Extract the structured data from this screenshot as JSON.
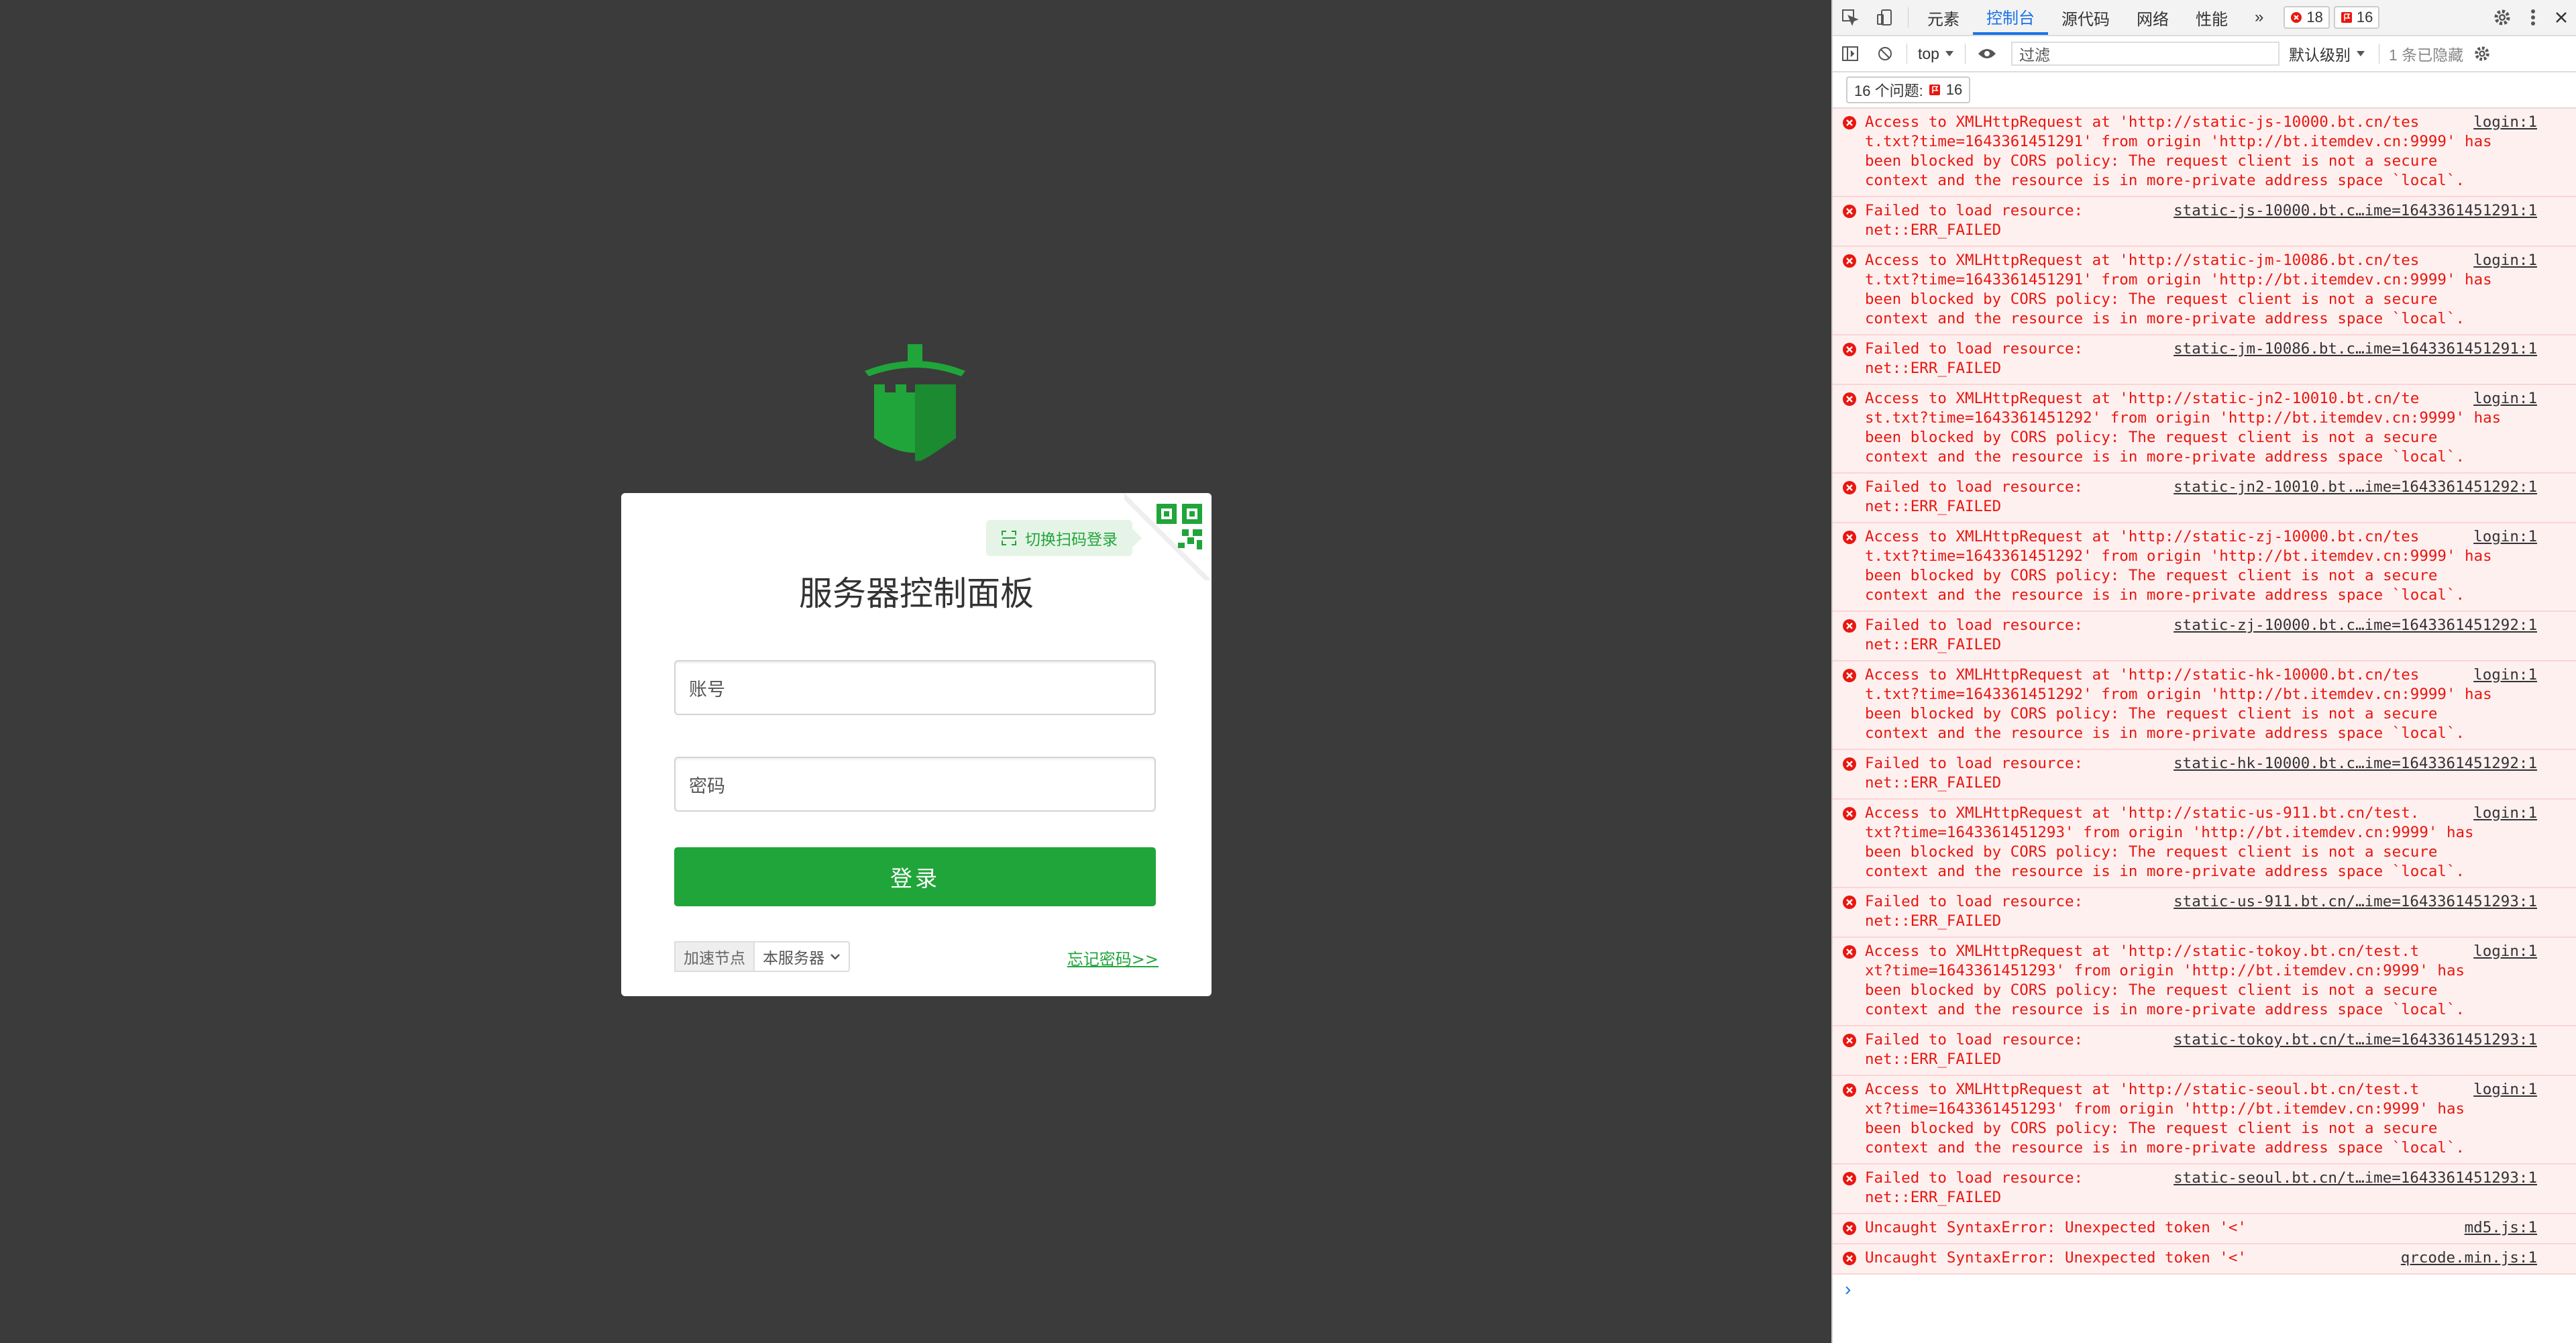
{
  "page": {
    "title": "服务器控制面板",
    "qr_switch_label": "切换扫码登录",
    "username_placeholder": "账号",
    "password_placeholder": "密码",
    "login_button": "登录",
    "node_label": "加速节点",
    "node_select_value": "本服务器",
    "forgot_password": "忘记密码>>",
    "brand_color": "#20a53a"
  },
  "devtools": {
    "tabs": [
      "元素",
      "控制台",
      "源代码",
      "网络",
      "性能"
    ],
    "active_tab": "控制台",
    "more_tabs": "»",
    "error_count": "18",
    "issue_count": "16",
    "context": "top",
    "filter_placeholder": "过滤",
    "level": "默认级别",
    "hidden_count": "1 条已隐藏",
    "issues_label": "16 个问题:",
    "issues_badge": "16",
    "messages": [
      {
        "lines": [
          "Access to XMLHttpRequest at 'http://static-js-10000.bt.cn/tes",
          "t.txt?time=1643361451291' from origin 'http://bt.itemdev.cn:9999' has",
          "been blocked by CORS policy: The request client is not a secure",
          "context and the resource is in more-private address space `local`."
        ],
        "source": "login:1"
      },
      {
        "lines": [
          "Failed to load resource:",
          "net::ERR_FAILED"
        ],
        "source": "static-js-10000.bt.c…ime=1643361451291:1"
      },
      {
        "lines": [
          "Access to XMLHttpRequest at 'http://static-jm-10086.bt.cn/tes",
          "t.txt?time=1643361451291' from origin 'http://bt.itemdev.cn:9999' has",
          "been blocked by CORS policy: The request client is not a secure",
          "context and the resource is in more-private address space `local`."
        ],
        "source": "login:1"
      },
      {
        "lines": [
          "Failed to load resource:",
          "net::ERR_FAILED"
        ],
        "source": "static-jm-10086.bt.c…ime=1643361451291:1"
      },
      {
        "lines": [
          "Access to XMLHttpRequest at 'http://static-jn2-10010.bt.cn/te",
          "st.txt?time=1643361451292' from origin 'http://bt.itemdev.cn:9999' has",
          "been blocked by CORS policy: The request client is not a secure",
          "context and the resource is in more-private address space `local`."
        ],
        "source": "login:1"
      },
      {
        "lines": [
          "Failed to load resource:",
          "net::ERR_FAILED"
        ],
        "source": "static-jn2-10010.bt.…ime=1643361451292:1"
      },
      {
        "lines": [
          "Access to XMLHttpRequest at 'http://static-zj-10000.bt.cn/tes",
          "t.txt?time=1643361451292' from origin 'http://bt.itemdev.cn:9999' has",
          "been blocked by CORS policy: The request client is not a secure",
          "context and the resource is in more-private address space `local`."
        ],
        "source": "login:1"
      },
      {
        "lines": [
          "Failed to load resource:",
          "net::ERR_FAILED"
        ],
        "source": "static-zj-10000.bt.c…ime=1643361451292:1"
      },
      {
        "lines": [
          "Access to XMLHttpRequest at 'http://static-hk-10000.bt.cn/tes",
          "t.txt?time=1643361451292' from origin 'http://bt.itemdev.cn:9999' has",
          "been blocked by CORS policy: The request client is not a secure",
          "context and the resource is in more-private address space `local`."
        ],
        "source": "login:1"
      },
      {
        "lines": [
          "Failed to load resource:",
          "net::ERR_FAILED"
        ],
        "source": "static-hk-10000.bt.c…ime=1643361451292:1"
      },
      {
        "lines": [
          "Access to XMLHttpRequest at 'http://static-us-911.bt.cn/test.",
          "txt?time=1643361451293' from origin 'http://bt.itemdev.cn:9999' has",
          "been blocked by CORS policy: The request client is not a secure",
          "context and the resource is in more-private address space `local`."
        ],
        "source": "login:1"
      },
      {
        "lines": [
          "Failed to load resource:",
          "net::ERR_FAILED"
        ],
        "source": "static-us-911.bt.cn/…ime=1643361451293:1"
      },
      {
        "lines": [
          "Access to XMLHttpRequest at 'http://static-tokoy.bt.cn/test.t",
          "xt?time=1643361451293' from origin 'http://bt.itemdev.cn:9999' has",
          "been blocked by CORS policy: The request client is not a secure",
          "context and the resource is in more-private address space `local`."
        ],
        "source": "login:1"
      },
      {
        "lines": [
          "Failed to load resource:",
          "net::ERR_FAILED"
        ],
        "source": "static-tokoy.bt.cn/t…ime=1643361451293:1"
      },
      {
        "lines": [
          "Access to XMLHttpRequest at 'http://static-seoul.bt.cn/test.t",
          "xt?time=1643361451293' from origin 'http://bt.itemdev.cn:9999' has",
          "been blocked by CORS policy: The request client is not a secure",
          "context and the resource is in more-private address space `local`."
        ],
        "source": "login:1"
      },
      {
        "lines": [
          "Failed to load resource:",
          "net::ERR_FAILED"
        ],
        "source": "static-seoul.bt.cn/t…ime=1643361451293:1"
      },
      {
        "lines": [
          "Uncaught SyntaxError: Unexpected token '<'"
        ],
        "source": "md5.js:1"
      },
      {
        "lines": [
          "Uncaught SyntaxError: Unexpected token '<'"
        ],
        "source": "qrcode.min.js:1"
      }
    ],
    "prompt": "›"
  }
}
